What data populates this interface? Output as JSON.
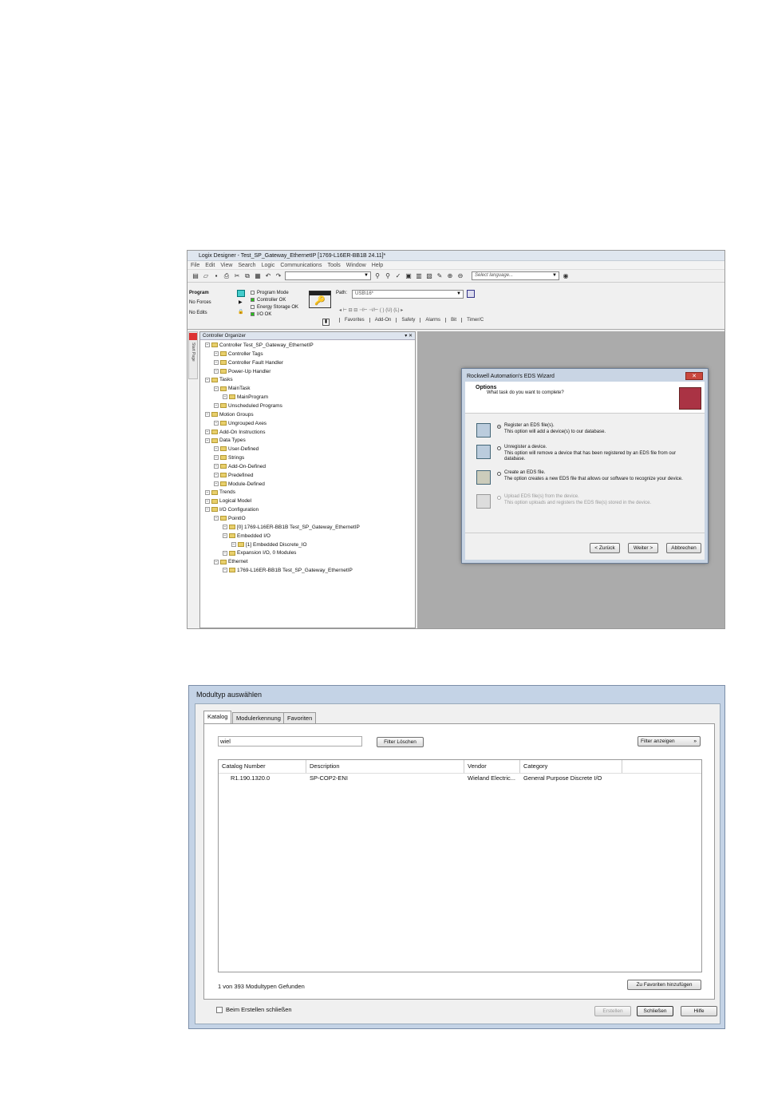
{
  "screen1": {
    "title": "Logix Designer - Test_SP_Gateway_EthernetIP [1769-L16ER-BB1B 24.11]*",
    "menu": [
      "File",
      "Edit",
      "View",
      "Search",
      "Logic",
      "Communications",
      "Tools",
      "Window",
      "Help"
    ],
    "language_placeholder": "Select language...",
    "path_label": "Path:",
    "path_value": "USB\\16*",
    "mode": "Program",
    "forces": "No Forces",
    "edits": "No Edits",
    "status": [
      "Program Mode",
      "Controller OK",
      "Energy Storage OK",
      "I/O OK"
    ],
    "status_colors": [
      "#ffffff",
      "#27c21a",
      "#ffffff",
      "#27c21a"
    ],
    "instruction_tabs": [
      "Favorites",
      "Add-On",
      "Safety",
      "Alarms",
      "Bit",
      "Timer/C"
    ],
    "organizer_title": "Controller Organizer",
    "quick_start": "Start Page",
    "tree": [
      {
        "label": "Controller Test_SP_Gateway_EthernetIP",
        "level": 0
      },
      {
        "label": "Controller Tags",
        "level": 1
      },
      {
        "label": "Controller Fault Handler",
        "level": 1
      },
      {
        "label": "Power-Up Handler",
        "level": 1
      },
      {
        "label": "Tasks",
        "level": 0
      },
      {
        "label": "MainTask",
        "level": 1
      },
      {
        "label": "MainProgram",
        "level": 2
      },
      {
        "label": "Unscheduled Programs",
        "level": 1
      },
      {
        "label": "Motion Groups",
        "level": 0
      },
      {
        "label": "Ungrouped Axes",
        "level": 1
      },
      {
        "label": "Add-On Instructions",
        "level": 0
      },
      {
        "label": "Data Types",
        "level": 0
      },
      {
        "label": "User-Defined",
        "level": 1
      },
      {
        "label": "Strings",
        "level": 1
      },
      {
        "label": "Add-On-Defined",
        "level": 1
      },
      {
        "label": "Predefined",
        "level": 1
      },
      {
        "label": "Module-Defined",
        "level": 1
      },
      {
        "label": "Trends",
        "level": 0
      },
      {
        "label": "Logical Model",
        "level": 0
      },
      {
        "label": "I/O Configuration",
        "level": 0
      },
      {
        "label": "PointIO",
        "level": 1
      },
      {
        "label": "[0] 1769-L16ER-BB1B Test_SP_Gateway_EthernetIP",
        "level": 2
      },
      {
        "label": "Embedded I/O",
        "level": 2
      },
      {
        "label": "[1] Embedded Discrete_IO",
        "level": 3
      },
      {
        "label": "Expansion I/O, 0 Modules",
        "level": 2
      },
      {
        "label": "Ethernet",
        "level": 1
      },
      {
        "label": "1769-L16ER-BB1B Test_SP_Gateway_EthernetIP",
        "level": 2
      }
    ],
    "eds": {
      "title": "Rockwell Automation's EDS Wizard",
      "close": "✕",
      "heading": "Options",
      "question": "What task do you want to complete?",
      "options": [
        {
          "label": "Register an EDS file(s).",
          "desc": "This option will add a device(s) to our database."
        },
        {
          "label": "Unregister a device.",
          "desc": "This option will remove a device that has been registered by an EDS file from our database."
        },
        {
          "label": "Create an EDS file.",
          "desc": "The option creates a new EDS file that allows our software to recognize your device."
        },
        {
          "label": "Upload EDS file(s) from the device.",
          "desc": "This option uploads and registers the EDS file(s) stored in the device."
        }
      ],
      "back": "< Zurück",
      "next": "Weiter >",
      "cancel": "Abbrechen"
    }
  },
  "screen2": {
    "title": "Modultyp auswählen",
    "tabs": [
      "Katalog",
      "Modulerkennung",
      "Favoriten"
    ],
    "search_value": "wiel",
    "clear_filter": "Filter Löschen",
    "show_filter": "Filter anzeigen",
    "columns": [
      "Catalog Number",
      "Description",
      "Vendor",
      "Category"
    ],
    "rows": [
      {
        "catalog": "R1.190.1320.0",
        "description": "SP-COP2-ENI",
        "vendor": "Wieland Electric...",
        "category": "General Purpose Discrete I/O"
      }
    ],
    "count_text": "1 von 393 Modultypen Gefunden",
    "add_favorites": "Zu Favoriten hinzufügen",
    "close_on_create": "Beim Erstellen schließen",
    "create": "Erstellen",
    "close": "Schließen",
    "help": "Hilfe"
  }
}
